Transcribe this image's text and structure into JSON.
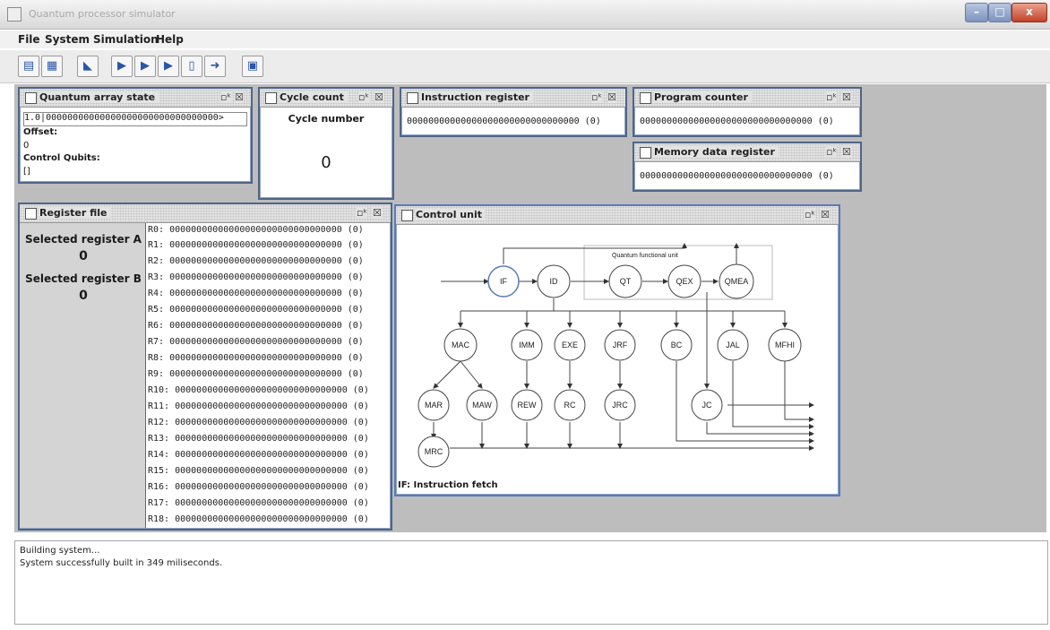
{
  "window": {
    "title": "Quantum processor simulator"
  },
  "menu": [
    "File",
    "System",
    "Simulation",
    "Help"
  ],
  "toolbar": {
    "icons": [
      "load-icon",
      "load-step-icon",
      "chip-icon",
      "run-icon",
      "step-icon",
      "step-into-icon",
      "step-out-icon",
      "forward-icon",
      "memory-icon"
    ]
  },
  "quantum_array": {
    "title": "Quantum array state",
    "value": "1.0|00000000000000000000000000000000>",
    "offset_label": "Offset:",
    "offset_value": "0",
    "control_label": "Control Qubits:",
    "control_value": "[]"
  },
  "cycle": {
    "title": "Cycle count",
    "label": "Cycle number",
    "value": "0"
  },
  "ir": {
    "title": "Instruction register",
    "value": "00000000000000000000000000000000 (0)"
  },
  "pc": {
    "title": "Program counter",
    "value": "00000000000000000000000000000000 (0)"
  },
  "mdr": {
    "title": "Memory data register",
    "value": "00000000000000000000000000000000 (0)"
  },
  "regfile": {
    "title": "Register file",
    "sel_a_label": "Selected register A",
    "sel_a_value": "0",
    "sel_b_label": "Selected register B",
    "sel_b_value": "0",
    "registers": [
      "R0: 00000000000000000000000000000000 (0)",
      "R1: 00000000000000000000000000000000 (0)",
      "R2: 00000000000000000000000000000000 (0)",
      "R3: 00000000000000000000000000000000 (0)",
      "R4: 00000000000000000000000000000000 (0)",
      "R5: 00000000000000000000000000000000 (0)",
      "R6: 00000000000000000000000000000000 (0)",
      "R7: 00000000000000000000000000000000 (0)",
      "R8: 00000000000000000000000000000000 (0)",
      "R9: 00000000000000000000000000000000 (0)",
      "R10: 00000000000000000000000000000000 (0)",
      "R11: 00000000000000000000000000000000 (0)",
      "R12: 00000000000000000000000000000000 (0)",
      "R13: 00000000000000000000000000000000 (0)",
      "R14: 00000000000000000000000000000000 (0)",
      "R15: 00000000000000000000000000000000 (0)",
      "R16: 00000000000000000000000000000000 (0)",
      "R17: 00000000000000000000000000000000 (0)",
      "R18: 00000000000000000000000000000000 (0)"
    ]
  },
  "control": {
    "title": "Control unit",
    "qfu_label": "Quantum functional unit",
    "states": [
      "IF",
      "ID",
      "QT",
      "QEX",
      "QMEA",
      "MAC",
      "IMM",
      "EXE",
      "JRF",
      "BC",
      "JAL",
      "MFHI",
      "MAR",
      "MAW",
      "REW",
      "RC",
      "JRC",
      "JC",
      "MRC"
    ],
    "caption": "IF: Instruction fetch"
  },
  "console": [
    "Building system...",
    "System successfully built in 349 miliseconds."
  ]
}
